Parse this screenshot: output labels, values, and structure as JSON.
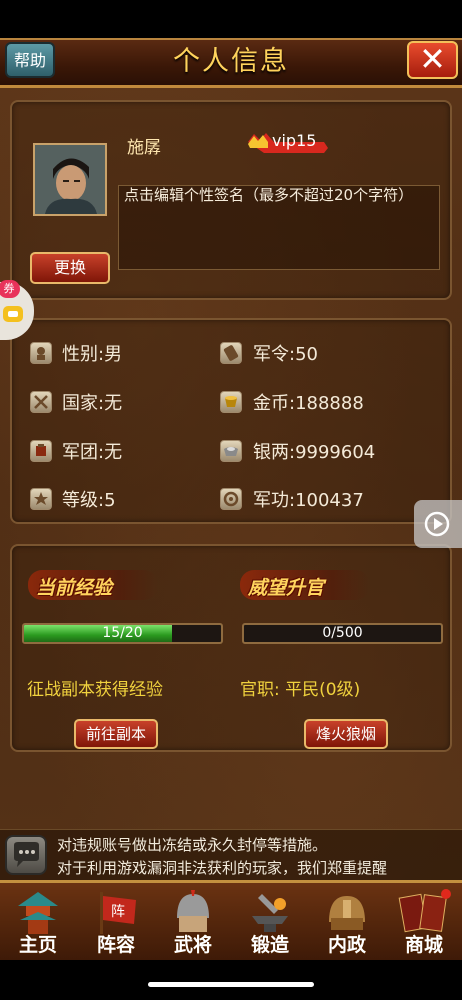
{
  "header": {
    "title": "个人信息",
    "help_label": "帮助",
    "close_label": "✕"
  },
  "profile": {
    "name": "施孱",
    "vip": "vip15",
    "signature": "点击编辑个性签名（最多不超过20个字符）",
    "change_button": "更换"
  },
  "stats_left": [
    {
      "icon": "gender-icon",
      "label": "性别:男"
    },
    {
      "icon": "nation-icon",
      "label": "国家:无"
    },
    {
      "icon": "legion-icon",
      "label": "军团:无"
    },
    {
      "icon": "level-star-icon",
      "label": "等级:5"
    }
  ],
  "stats_right": [
    {
      "icon": "army-order-icon",
      "label": "军令:50"
    },
    {
      "icon": "gold-coin-icon",
      "label": "金币:188888"
    },
    {
      "icon": "silver-icon",
      "label": "银两:9999604"
    },
    {
      "icon": "merit-icon",
      "label": "军功:100437"
    }
  ],
  "experience": {
    "header": "当前经验",
    "progress_text": "15/20",
    "current": 15,
    "max": 20,
    "hint": "征战副本获得经验",
    "button": "前往副本"
  },
  "prestige": {
    "header": "威望升官",
    "progress_text": "0/500",
    "current": 0,
    "max": 500,
    "rank": "官职: 平民(0级)",
    "button": "烽火狼烟"
  },
  "notice": {
    "line1": "对违规账号做出冻结或永久封停等措施。",
    "line2": "对于利用游戏漏洞非法获利的玩家，我们郑重提醒"
  },
  "floating": {
    "coupon_label": "券"
  },
  "nav": [
    {
      "label": "主页",
      "icon": "pagoda-icon"
    },
    {
      "label": "阵容",
      "icon": "battle-flag-icon"
    },
    {
      "label": "武将",
      "icon": "general-helmet-icon"
    },
    {
      "label": "锻造",
      "icon": "forge-anvil-icon"
    },
    {
      "label": "内政",
      "icon": "bronze-helmet-icon"
    },
    {
      "label": "商城",
      "icon": "shop-cards-icon"
    }
  ],
  "colors": {
    "accent_gold": "#ffd35c",
    "exp_green": "#2b9a1f",
    "button_red": "#a61d0d",
    "wood": "#4c2b13"
  }
}
